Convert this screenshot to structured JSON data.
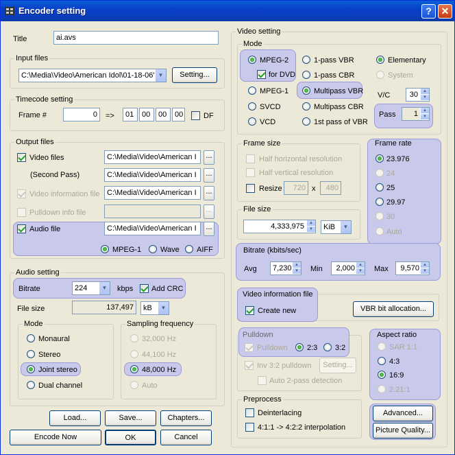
{
  "window": {
    "title": "Encoder setting",
    "help": "?",
    "close": "✕",
    "icon": "film-icon"
  },
  "title_field": {
    "label": "Title",
    "value": "ai.avs"
  },
  "input_files": {
    "caption": "Input files",
    "path": "C:\\Media\\Video\\American Idol\\01-18-06'",
    "setting": "Setting..."
  },
  "timecode": {
    "caption": "Timecode setting",
    "frame_label": "Frame #",
    "frame": "0",
    "arrow": "=>",
    "hh": "01",
    "mm": "00",
    "ss": "00",
    "ff": "00",
    "df": "DF"
  },
  "output_files": {
    "caption": "Output files",
    "video": "Video files",
    "video_path": "C:\\Media\\Video\\American I",
    "second": "(Second Pass)",
    "second_path": "C:\\Media\\Video\\American I",
    "vinfo": "Video information file",
    "vinfo_path": "C:\\Media\\Video\\American I",
    "pulldown": "Pulldown info file",
    "audio": "Audio file",
    "audio_path": "C:\\Media\\Video\\American I",
    "browse": "...",
    "mpeg1": "MPEG-1",
    "wave": "Wave",
    "aiff": "AIFF"
  },
  "audio_setting": {
    "caption": "Audio setting",
    "bitrate": "Bitrate",
    "bitrate_value": "224",
    "kbps": "kbps",
    "add_crc": "Add CRC",
    "filesize": "File size",
    "filesize_value": "137,497",
    "unit": "kB",
    "mode_caption": "Mode",
    "monaural": "Monaural",
    "stereo": "Stereo",
    "joint": "Joint stereo",
    "dual": "Dual channel",
    "freq_caption": "Sampling frequency",
    "f32": "32,000 Hz",
    "f44": "44,100 Hz",
    "f48": "48,000 Hz",
    "auto": "Auto"
  },
  "buttons": {
    "load": "Load...",
    "save": "Save...",
    "chapters": "Chapters...",
    "encode": "Encode Now",
    "ok": "OK",
    "cancel": "Cancel"
  },
  "video_setting": {
    "caption": "Video setting",
    "mode_caption": "Mode",
    "mpeg2": "MPEG-2",
    "for_dvd": "for DVD",
    "mpeg1": "MPEG-1",
    "svcd": "SVCD",
    "vcd": "VCD",
    "vbr1": "1-pass VBR",
    "cbr1": "1-pass CBR",
    "multivbr": "Multipass VBR",
    "multicbr": "Multipass CBR",
    "firstvbr": "1st pass of VBR",
    "elementary": "Elementary",
    "system": "System",
    "vc": "V/C",
    "vc_value": "30",
    "pass": "Pass",
    "pass_value": "1"
  },
  "frame_size": {
    "caption": "Frame size",
    "horiz": "Half horizontal resolution",
    "vert": "Half vertical resolution",
    "resize": "Resize",
    "w": "720",
    "x": "x",
    "h": "480"
  },
  "frame_rate": {
    "caption": "Frame rate",
    "options": [
      "23.976",
      "24",
      "25",
      "29.97",
      "30",
      "Auto"
    ]
  },
  "file_size": {
    "caption": "File size",
    "value": "4,333,975",
    "unit": "KiB"
  },
  "bitrate": {
    "caption": "Bitrate (kbits/sec)",
    "avg": "Avg",
    "avg_value": "7,230",
    "min": "Min",
    "min_value": "2,000",
    "max": "Max",
    "max_value": "9,570"
  },
  "vinfo": {
    "caption": "Video information file",
    "create": "Create new",
    "vbr_alloc": "VBR bit allocation..."
  },
  "pulldown": {
    "caption": "Pulldown",
    "pulldown": "Pulldown",
    "r23": "2:3",
    "r32": "3:2",
    "inv": "Inv 3:2 pulldown",
    "setting": "Setting...",
    "auto2": "Auto 2-pass detection"
  },
  "aspect": {
    "caption": "Aspect ratio",
    "options": [
      "SAR 1:1",
      "4:3",
      "16:9",
      "2.21:1"
    ]
  },
  "preprocess": {
    "caption": "Preprocess",
    "deinterlace": "Deinterlacing",
    "interp": "4:1:1 -> 4:2:2 interpolation"
  },
  "right_buttons": {
    "advanced": "Advanced...",
    "pq": "Picture Quality..."
  }
}
